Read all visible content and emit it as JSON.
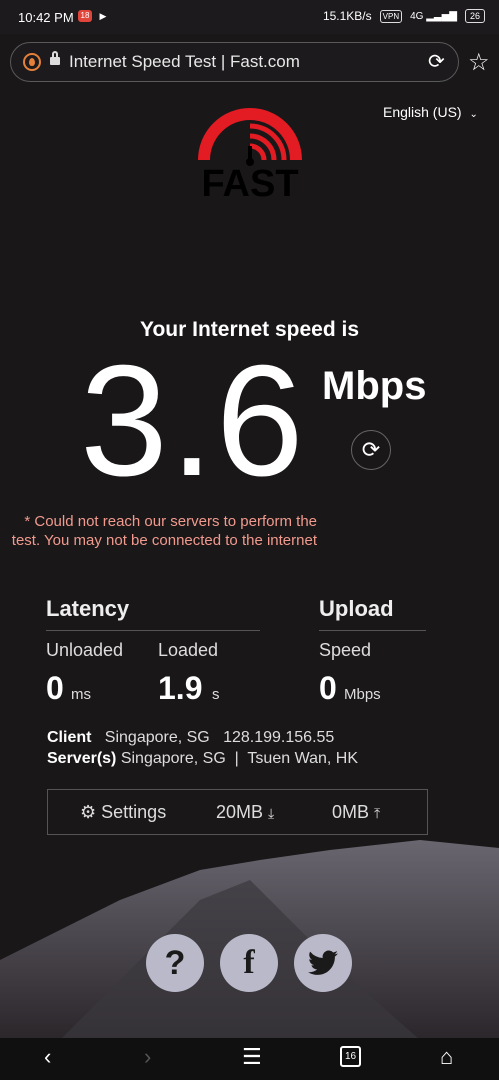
{
  "status_bar": {
    "time": "10:42 PM",
    "network_speed": "15.1KB/s",
    "vpn": "VPN",
    "signal": "4G",
    "battery": "26"
  },
  "browser": {
    "url_text": "Internet Speed Test | Fast.com",
    "reload_icon": "reload-icon",
    "bookmark_icon": "star-icon"
  },
  "page": {
    "language": "English (US)",
    "logo_text": "FAST",
    "headline": "Your Internet speed is",
    "speed_value": "3.6",
    "speed_unit": "Mbps",
    "error": "* Could not reach our servers to perform the test. You may not be connected to the internet",
    "latency": {
      "title": "Latency",
      "unloaded_label": "Unloaded",
      "unloaded_value": "0",
      "unloaded_unit": "ms",
      "loaded_label": "Loaded",
      "loaded_value": "1.9",
      "loaded_unit": "s"
    },
    "upload": {
      "title": "Upload",
      "speed_label": "Speed",
      "speed_value": "0",
      "speed_unit": "Mbps"
    },
    "client": {
      "label": "Client",
      "location": "Singapore, SG",
      "ip": "128.199.156.55"
    },
    "servers": {
      "label": "Server(s)",
      "value": "Singapore, SG  |  Tsuen Wan, HK"
    },
    "settings": {
      "label": "Settings",
      "download": "20MB",
      "upload": "0MB"
    },
    "social": {
      "help": "?",
      "facebook": "f"
    }
  },
  "nav": {
    "tab_count": "16"
  },
  "colors": {
    "background": "#1a1719",
    "accent_red": "#e31b23",
    "error_text": "#f19a8d",
    "social_bg": "#b9b9c9"
  }
}
